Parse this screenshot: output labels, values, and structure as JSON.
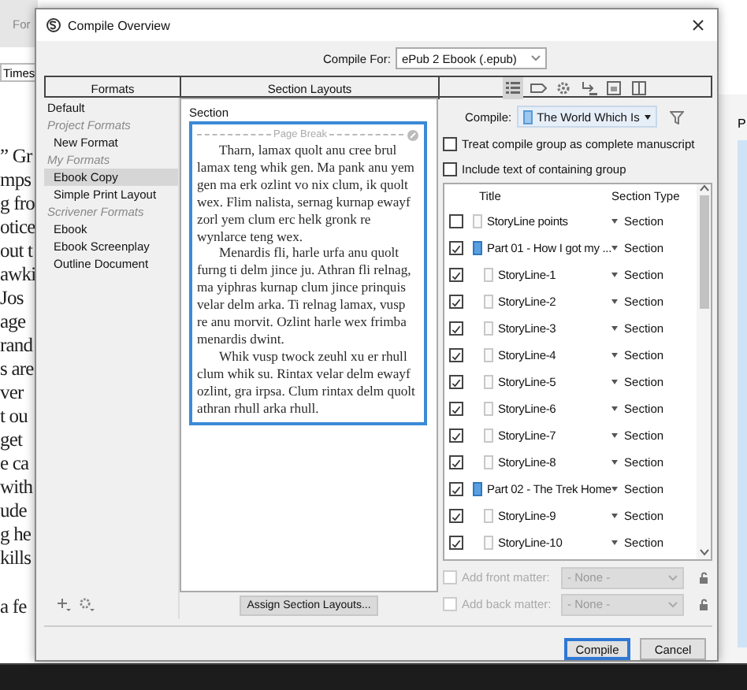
{
  "background": {
    "toolbar_label": "For",
    "font_field": "Times",
    "editor_lines": [
      "” Gr",
      "mps",
      "g fro",
      "otice",
      "out t",
      "awki",
      "Jos",
      "age",
      "rand",
      "s are",
      "ver",
      "t ou",
      "get",
      "e ca",
      "with",
      "ude",
      "g he",
      "kills"
    ],
    "editor_tail": "a fe",
    "side_label": "P"
  },
  "dialog": {
    "title": "Compile Overview",
    "compile_for": {
      "label": "Compile For:",
      "value": "ePub 2 Ebook (.epub)"
    },
    "headers": [
      "Formats",
      "Section Layouts"
    ],
    "pane_tabs": [
      {
        "kind": "list",
        "selected": true
      },
      {
        "kind": "label",
        "selected": false
      },
      {
        "kind": "gear",
        "selected": false
      },
      {
        "kind": "replace",
        "selected": false
      },
      {
        "kind": "image",
        "selected": false
      },
      {
        "kind": "page",
        "selected": false
      }
    ],
    "formats": [
      {
        "label": "Default",
        "kind": "format",
        "selected": false
      },
      {
        "label": "Project Formats",
        "kind": "group",
        "selected": false,
        "children": [
          {
            "label": "New Format",
            "kind": "format",
            "selected": false
          }
        ]
      },
      {
        "label": "My Formats",
        "kind": "group",
        "selected": false,
        "children": [
          {
            "label": "Ebook Copy",
            "kind": "format",
            "selected": true
          },
          {
            "label": "Simple Print Layout",
            "kind": "format",
            "selected": false
          }
        ]
      },
      {
        "label": "Scrivener Formats",
        "kind": "group",
        "selected": false,
        "children": [
          {
            "label": "Ebook",
            "kind": "format",
            "selected": false
          },
          {
            "label": "Ebook Screenplay",
            "kind": "format",
            "selected": false
          },
          {
            "label": "Outline Document",
            "kind": "format",
            "selected": false
          }
        ]
      }
    ],
    "section_panel": {
      "label": "Section",
      "layouts": [
        {
          "selected": true,
          "page_break": "Page Break",
          "paragraphs": [
            "Tharn, lamax quolt anu cree brul lamax teng whik gen. Ma pank anu yem gen ma erk ozlint vo nix clum, ik quolt wex. Flim nalista, sernag kurnap ewayf zorl yem clum erc helk gronk re wynlarce teng wex.",
            "Menardis fli, harle urfa anu quolt furng ti delm jince ju. Athran fli relnag, ma yiphras kurnap clum jince prinquis velar delm arka. Ti relnag lamax, vusp re anu morvit. Ozlint harle wex frimba menardis dwint.",
            "Whik vusp twock zeuhl xu er rhull clum whik su. Rintax velar delm ewayf ozlint, gra irpsa. Clum rintax delm quolt athran rhull arka rhull."
          ]
        }
      ]
    },
    "assign_button": "Assign Section Layouts...",
    "compile": {
      "label": "Compile:",
      "value": "The World Which Is"
    },
    "options": [
      {
        "label": "Treat compile group as complete manuscript",
        "checked": false
      },
      {
        "label": "Include text of containing group",
        "checked": false
      }
    ],
    "table": {
      "columns": [
        "Title",
        "Section Type"
      ],
      "rows": [
        {
          "title": "StoryLine points",
          "kind": "doc",
          "checked": false,
          "section_type": "Section"
        },
        {
          "title": "Part 01 - How I got my ...",
          "kind": "folder",
          "checked": true,
          "section_type": "Section",
          "children": [
            {
              "title": "StoryLine-1",
              "kind": "doc",
              "checked": true,
              "section_type": "Section"
            },
            {
              "title": "StoryLine-2",
              "kind": "doc",
              "checked": true,
              "section_type": "Section"
            },
            {
              "title": "StoryLine-3",
              "kind": "doc",
              "checked": true,
              "section_type": "Section"
            },
            {
              "title": "StoryLine-4",
              "kind": "doc",
              "checked": true,
              "section_type": "Section"
            },
            {
              "title": "StoryLine-5",
              "kind": "doc",
              "checked": true,
              "section_type": "Section"
            },
            {
              "title": "StoryLine-6",
              "kind": "doc",
              "checked": true,
              "section_type": "Section"
            },
            {
              "title": "StoryLine-7",
              "kind": "doc",
              "checked": true,
              "section_type": "Section"
            },
            {
              "title": "StoryLine-8",
              "kind": "doc",
              "checked": true,
              "section_type": "Section"
            }
          ]
        },
        {
          "title": "Part 02 - The Trek Home",
          "kind": "folder",
          "checked": true,
          "section_type": "Section",
          "children": [
            {
              "title": "StoryLine-9",
              "kind": "doc",
              "checked": true,
              "section_type": "Section"
            },
            {
              "title": "StoryLine-10",
              "kind": "doc",
              "checked": true,
              "section_type": "Section"
            }
          ]
        }
      ]
    },
    "matter": [
      {
        "label": "Add front matter:",
        "checked": false,
        "value": "- None -",
        "disabled": true
      },
      {
        "label": "Add back matter:",
        "checked": false,
        "value": "- None -",
        "disabled": true
      }
    ],
    "buttons": [
      {
        "label": "Compile",
        "default": true
      },
      {
        "label": "Cancel",
        "default": false
      }
    ]
  }
}
